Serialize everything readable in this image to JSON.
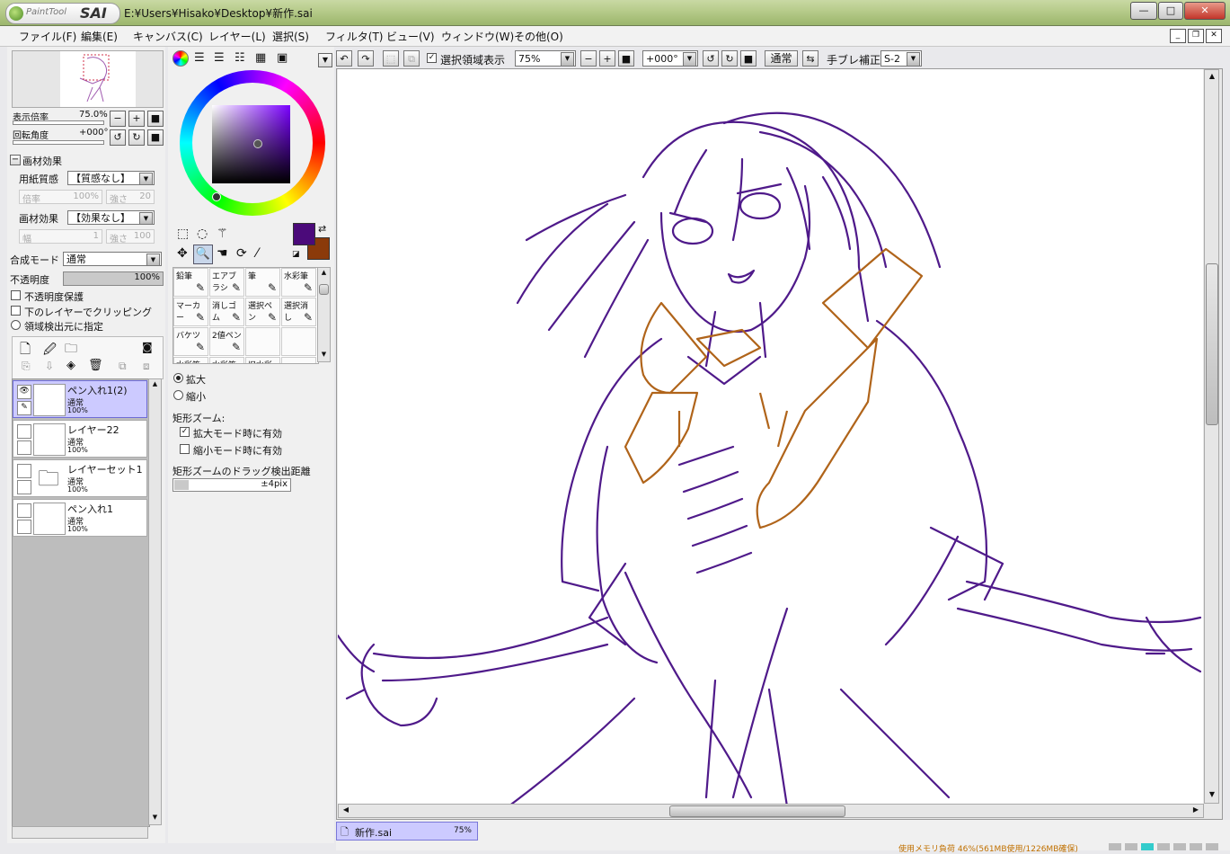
{
  "app": {
    "logo_small": "PaintTool",
    "logo_big": "SAI",
    "title": "E:¥Users¥Hisako¥Desktop¥新作.sai"
  },
  "window_controls": {
    "minimize": "—",
    "maximize": "□",
    "close": "✕"
  },
  "menu": [
    "ファイル(F)",
    "編集(E)",
    "キャンバス(C)",
    "レイヤー(L)",
    "選択(S)",
    "フィルタ(T)",
    "ビュー(V)",
    "ウィンドウ(W)",
    "その他(O)"
  ],
  "navigator": {
    "zoom_label": "表示倍率",
    "zoom_value": "75.0%",
    "angle_label": "回転角度",
    "angle_value": "+000°"
  },
  "material": {
    "header": "画材効果",
    "paper_label": "用紙質感",
    "paper_value": "【質感なし】",
    "scale_label": "倍率",
    "scale_value": "100%",
    "strength_label": "強さ",
    "strength_value": "20",
    "effect_label": "画材効果",
    "effect_value": "【効果なし】",
    "width_label": "幅",
    "width_value": "1",
    "strength2_label": "強さ",
    "strength2_value": "100"
  },
  "blend": {
    "mode_label": "合成モード",
    "mode_value": "通常",
    "opacity_label": "不透明度",
    "opacity_value": "100%",
    "opacity": 1.0
  },
  "options": {
    "preserve_opacity": "不透明度保護",
    "clip": "下のレイヤーでクリッピング",
    "select_source": "領域検出元に指定"
  },
  "layers": [
    {
      "name": "ペン入れ1(2)",
      "mode": "通常",
      "opacity": "100%",
      "selected": true,
      "visible": true
    },
    {
      "name": "レイヤー22",
      "mode": "通常",
      "opacity": "100%",
      "selected": false,
      "visible": false
    },
    {
      "name": "レイヤーセット1",
      "mode": "通常",
      "opacity": "100%",
      "selected": false,
      "visible": false
    },
    {
      "name": "ペン入れ1",
      "mode": "通常",
      "opacity": "100%",
      "selected": false,
      "visible": false
    }
  ],
  "colors": {
    "primary": "#4b0a7a",
    "secondary": "#8b3a0a",
    "line": "#4f1a8a",
    "orange": "#b0641a",
    "selection": "#cccaff"
  },
  "tools": [
    {
      "label": "鉛筆",
      "icon": "pencil-icon"
    },
    {
      "label": "エアブラシ",
      "icon": "airbrush-icon"
    },
    {
      "label": "筆",
      "icon": "brush-icon"
    },
    {
      "label": "水彩筆",
      "icon": "watercolor-icon"
    },
    {
      "label": "マーカー",
      "icon": "marker-icon"
    },
    {
      "label": "消しゴム",
      "icon": "eraser-icon"
    },
    {
      "label": "選択ペン",
      "icon": "select-pen-icon"
    },
    {
      "label": "選択消し",
      "icon": "select-erase-icon"
    },
    {
      "label": "バケツ",
      "icon": "bucket-icon"
    },
    {
      "label": "2値ペン",
      "icon": "binary-pen-icon"
    },
    {
      "label": "",
      "icon": ""
    },
    {
      "label": "",
      "icon": ""
    },
    {
      "label": "水彩筆",
      "icon": ""
    },
    {
      "label": "水彩筆",
      "icon": ""
    },
    {
      "label": "旧水彩",
      "icon": ""
    },
    {
      "label": "",
      "icon": ""
    }
  ],
  "zoom_tool": {
    "zoom_in": "拡大",
    "zoom_out": "縮小",
    "rect_label": "矩形ズーム:",
    "rect_in": "拡大モード時に有効",
    "rect_out": "縮小モード時に有効",
    "drag_label": "矩形ズームのドラッグ検出距離",
    "drag_value": "±4pix"
  },
  "toolbar": {
    "show_selection": "選択領域表示",
    "zoom": "75%",
    "angle": "+000°",
    "blend": "通常",
    "stabilizer_label": "手ブレ補正",
    "stabilizer_value": "S-2"
  },
  "document_tab": {
    "name": "新作.sai",
    "zoom": "75%"
  },
  "status": {
    "memory": "使用メモリ負荷 46%(561MB使用/1226MB確保)"
  }
}
